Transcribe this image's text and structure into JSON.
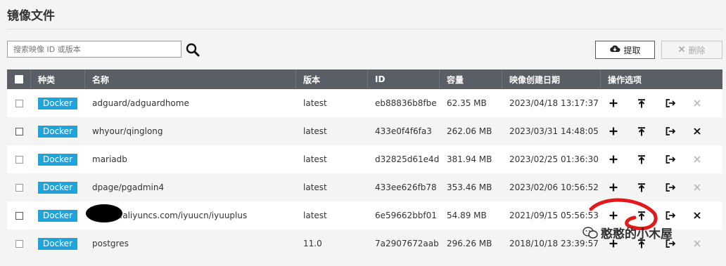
{
  "page": {
    "title": "镜像文件"
  },
  "toolbar": {
    "search_placeholder": "搜索映像 ID 或版本",
    "pull_label": "提取",
    "delete_label": "删除"
  },
  "table": {
    "headers": {
      "type": "种类",
      "name": "名称",
      "version": "版本",
      "id": "ID",
      "size": "容量",
      "created": "映像创建日期",
      "actions": "操作选项"
    },
    "rows": [
      {
        "type": "Docker",
        "name": "adguard/adguardhome",
        "version": "latest",
        "id": "eb88836b8fbe",
        "size": "62.35 MB",
        "created": "2023/04/18 13:17:37",
        "delete_enabled": false
      },
      {
        "type": "Docker",
        "name": "whyour/qinglong",
        "version": "latest",
        "id": "433e0f4f6fa3",
        "size": "262.06 MB",
        "created": "2023/03/31 14:48:05",
        "delete_enabled": true
      },
      {
        "type": "Docker",
        "name": "mariadb",
        "version": "latest",
        "id": "d32825d61e4d",
        "size": "381.94 MB",
        "created": "2023/02/25 01:36:30",
        "delete_enabled": false
      },
      {
        "type": "Docker",
        "name": "dpage/pgadmin4",
        "version": "latest",
        "id": "433ee626fb78",
        "size": "353.46 MB",
        "created": "2023/02/06 10:56:52",
        "delete_enabled": false
      },
      {
        "type": "Docker",
        "name": ".mirror.aliyuncs.com/iyuucn/iyuuplus",
        "version": "latest",
        "id": "6e59662bbf01",
        "size": "54.89 MB",
        "created": "2021/09/15 05:56:53",
        "delete_enabled": true
      },
      {
        "type": "Docker",
        "name": "postgres",
        "version": "11.0",
        "id": "7a2907672aab",
        "size": "296.26 MB",
        "created": "2018/10/18 23:39:57",
        "delete_enabled": false
      }
    ]
  },
  "overlay": {
    "watermark": "憨憨的小木屋"
  },
  "colors": {
    "header_bg": "#5a5f66",
    "badge": "#1fa3dd",
    "annotation": "#e0191b"
  }
}
